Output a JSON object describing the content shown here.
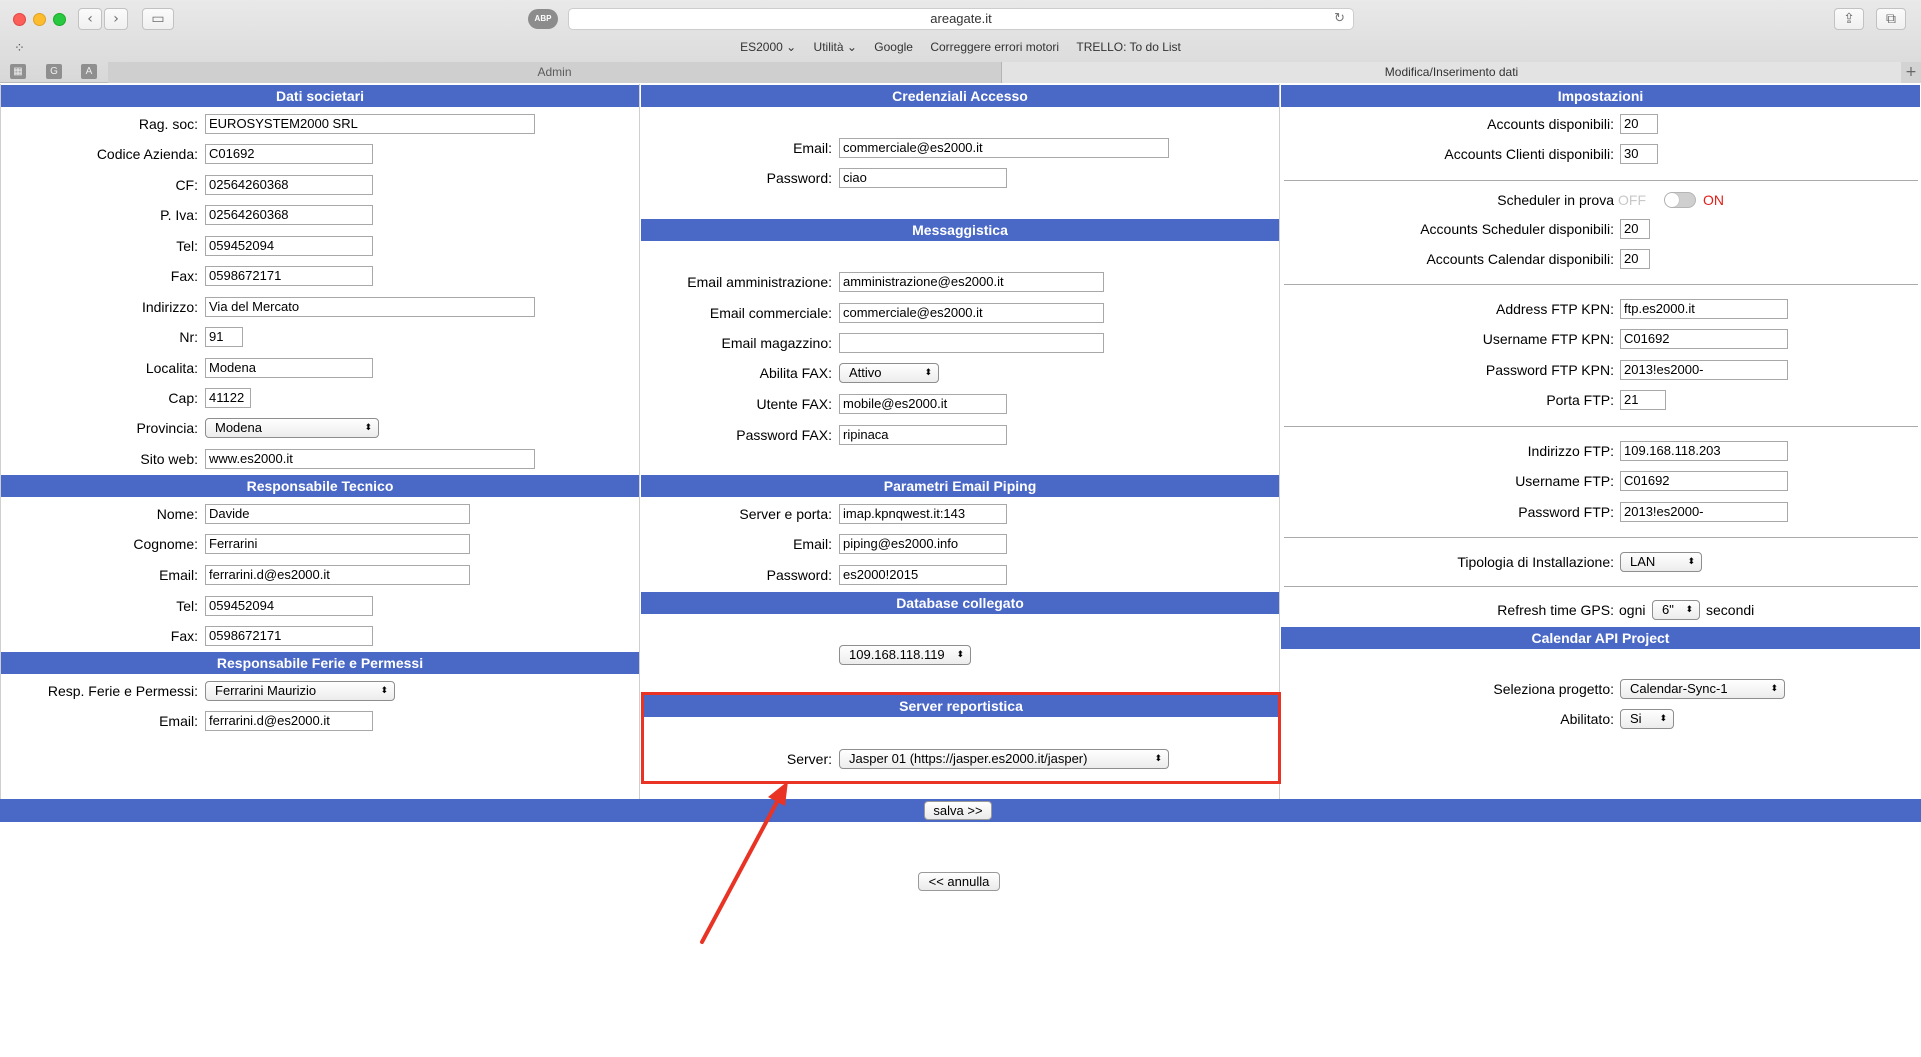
{
  "browser": {
    "url": "areagate.it",
    "abp_label": "ABP",
    "bookmarks": [
      "ES2000 ⌄",
      "Utilità ⌄",
      "Google",
      "Correggere errori motori",
      "TRELLO: To do List"
    ],
    "pinned_tabs": [
      "G",
      "A"
    ],
    "tabs": [
      {
        "label": "Admin",
        "active": false
      },
      {
        "label": "Modifica/Inserimento dati",
        "active": true
      }
    ]
  },
  "dati_societari": {
    "header": "Dati societari",
    "rag_soc": {
      "label": "Rag. soc:",
      "value": "EUROSYSTEM2000 SRL"
    },
    "codice_azienda": {
      "label": "Codice Azienda:",
      "value": "C01692"
    },
    "cf": {
      "label": "CF:",
      "value": "02564260368"
    },
    "piva": {
      "label": "P. Iva:",
      "value": "02564260368"
    },
    "tel": {
      "label": "Tel:",
      "value": "059452094"
    },
    "fax": {
      "label": "Fax:",
      "value": "0598672171"
    },
    "indirizzo": {
      "label": "Indirizzo:",
      "value": "Via del Mercato"
    },
    "nr": {
      "label": "Nr:",
      "value": "91"
    },
    "localita": {
      "label": "Localita:",
      "value": "Modena"
    },
    "cap": {
      "label": "Cap:",
      "value": "41122"
    },
    "provincia": {
      "label": "Provincia:",
      "value": "Modena"
    },
    "sito_web": {
      "label": "Sito web:",
      "value": "www.es2000.it"
    }
  },
  "responsabile_tecnico": {
    "header": "Responsabile Tecnico",
    "nome": {
      "label": "Nome:",
      "value": "Davide"
    },
    "cognome": {
      "label": "Cognome:",
      "value": "Ferrarini"
    },
    "email": {
      "label": "Email:",
      "value": "ferrarini.d@es2000.it"
    },
    "tel": {
      "label": "Tel:",
      "value": "059452094"
    },
    "fax": {
      "label": "Fax:",
      "value": "0598672171"
    }
  },
  "responsabile_ferie": {
    "header": "Responsabile Ferie e Permessi",
    "resp": {
      "label": "Resp. Ferie e Permessi:",
      "value": "Ferrarini Maurizio"
    },
    "email": {
      "label": "Email:",
      "value": "ferrarini.d@es2000.it"
    }
  },
  "credenziali_accesso": {
    "header": "Credenziali Accesso",
    "email": {
      "label": "Email:",
      "value": "commerciale@es2000.it"
    },
    "password": {
      "label": "Password:",
      "value": "ciao"
    }
  },
  "messaggistica": {
    "header": "Messaggistica",
    "email_amministrazione": {
      "label": "Email amministrazione:",
      "value": "amministrazione@es2000.it"
    },
    "email_commerciale": {
      "label": "Email commerciale:",
      "value": "commerciale@es2000.it"
    },
    "email_magazzino": {
      "label": "Email magazzino:",
      "value": ""
    },
    "abilita_fax": {
      "label": "Abilita FAX:",
      "value": "Attivo"
    },
    "utente_fax": {
      "label": "Utente FAX:",
      "value": "mobile@es2000.it"
    },
    "password_fax": {
      "label": "Password FAX:",
      "value": "ripinaca"
    }
  },
  "email_piping": {
    "header": "Parametri Email Piping",
    "server": {
      "label": "Server e porta:",
      "value": "imap.kpnqwest.it:143"
    },
    "email": {
      "label": "Email:",
      "value": "piping@es2000.info"
    },
    "password": {
      "label": "Password:",
      "value": "es2000!2015"
    }
  },
  "database_collegato": {
    "header": "Database collegato",
    "value": "109.168.118.119"
  },
  "server_reportistica": {
    "header": "Server reportistica",
    "server": {
      "label": "Server:",
      "value": "Jasper 01 (https://jasper.es2000.it/jasper)"
    }
  },
  "impostazioni": {
    "header": "Impostazioni",
    "accounts_disponibili": {
      "label": "Accounts disponibili:",
      "value": "20"
    },
    "accounts_clienti": {
      "label": "Accounts Clienti disponibili:",
      "value": "30"
    },
    "scheduler": {
      "label": "Scheduler in prova",
      "off": "OFF",
      "on": "ON"
    },
    "accounts_scheduler": {
      "label": "Accounts Scheduler disponibili:",
      "value": "20"
    },
    "accounts_calendar": {
      "label": "Accounts Calendar disponibili:",
      "value": "20"
    },
    "address_ftp_kpn": {
      "label": "Address FTP KPN:",
      "value": "ftp.es2000.it"
    },
    "username_ftp_kpn": {
      "label": "Username FTP KPN:",
      "value": "C01692"
    },
    "password_ftp_kpn": {
      "label": "Password FTP KPN:",
      "value": "2013!es2000-"
    },
    "porta_ftp": {
      "label": "Porta FTP:",
      "value": "21"
    },
    "indirizzo_ftp": {
      "label": "Indirizzo FTP:",
      "value": "109.168.118.203"
    },
    "username_ftp": {
      "label": "Username FTP:",
      "value": "C01692"
    },
    "password_ftp": {
      "label": "Password FTP:",
      "value": "2013!es2000-"
    },
    "tipologia": {
      "label": "Tipologia di Installazione:",
      "value": "LAN"
    },
    "refresh_gps": {
      "label": "Refresh time GPS:",
      "prefix": "ogni",
      "value": "6\"",
      "suffix": "secondi"
    }
  },
  "calendar_api": {
    "header": "Calendar API Project",
    "progetto": {
      "label": "Seleziona progetto:",
      "value": "Calendar-Sync-1"
    },
    "abilitato": {
      "label": "Abilitato:",
      "value": "Si"
    }
  },
  "actions": {
    "save_label": "salva >>",
    "cancel_label": "<< annulla"
  },
  "colors": {
    "section_header": "#4a68c5",
    "highlight": "#e83325",
    "toggle_on": "#e0201b"
  }
}
